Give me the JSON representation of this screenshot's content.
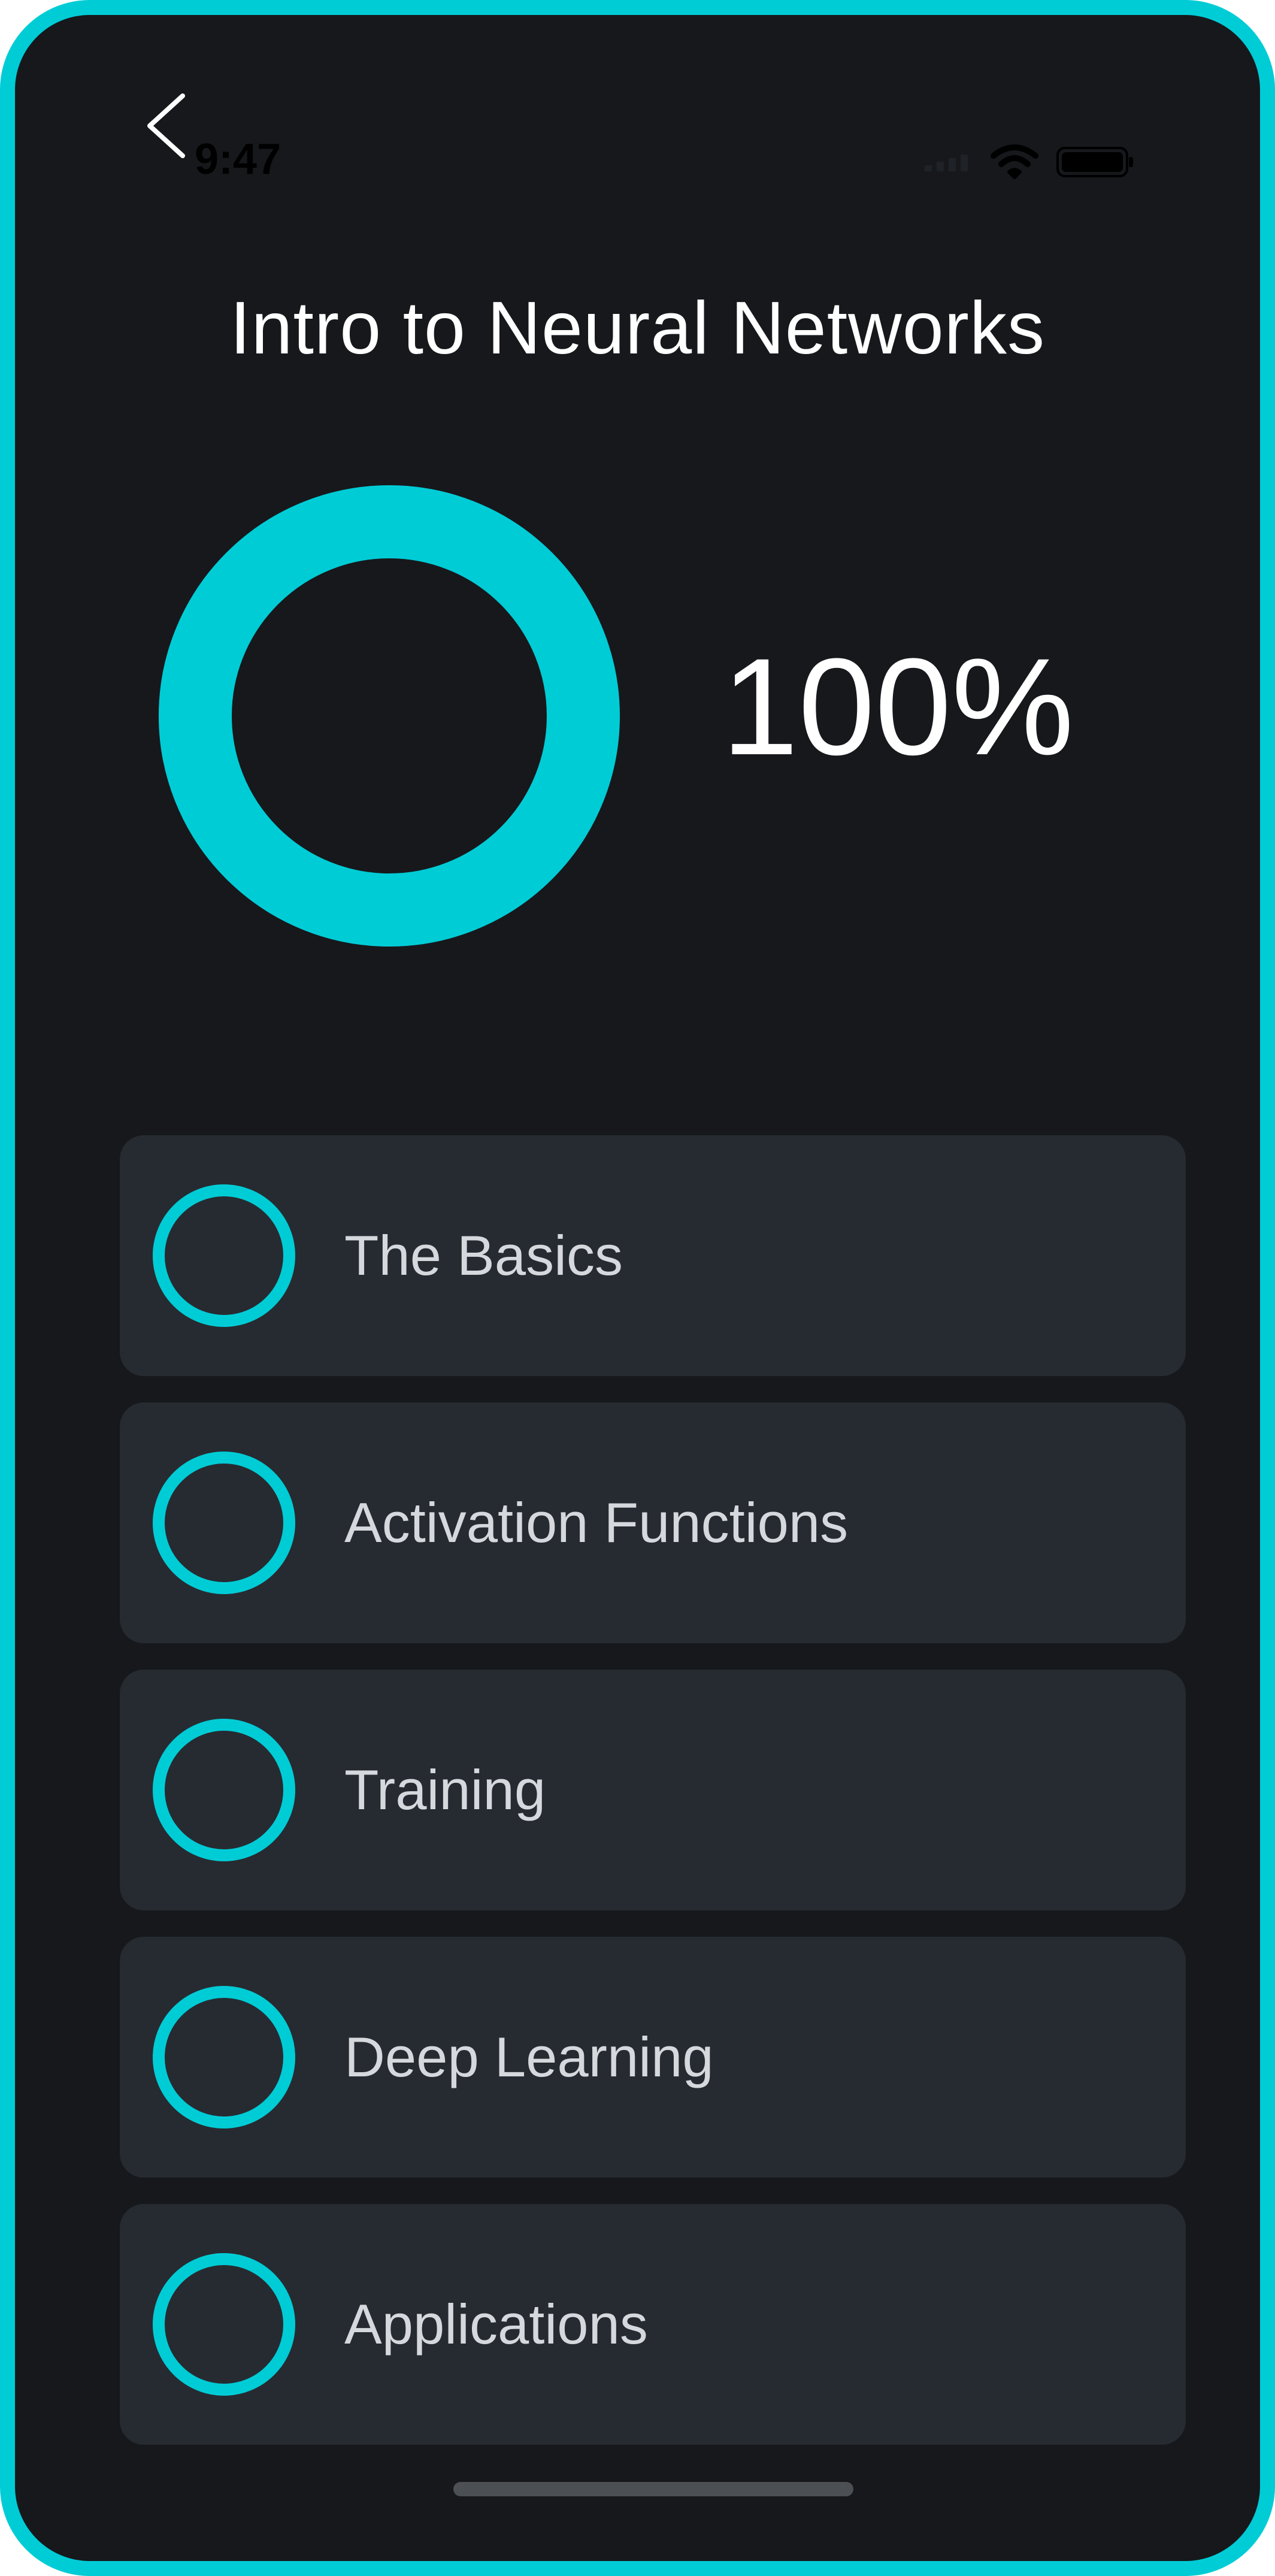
{
  "status_bar": {
    "time": "9:47",
    "icons": [
      "back-chevron-icon",
      "signal-icon",
      "wifi-icon",
      "battery-icon"
    ]
  },
  "course": {
    "title": "Intro to Neural Networks",
    "progress_text": "100%",
    "progress_fraction": 1.0
  },
  "lessons": [
    {
      "label": "The Basics"
    },
    {
      "label": "Activation Functions"
    },
    {
      "label": "Training"
    },
    {
      "label": "Deep Learning"
    },
    {
      "label": "Applications"
    }
  ],
  "colors": {
    "accent": "#00CCD6",
    "background": "#16181C",
    "card": "#262B31",
    "text_primary": "#FFFFFF",
    "text_secondary": "#D5D8DC"
  }
}
